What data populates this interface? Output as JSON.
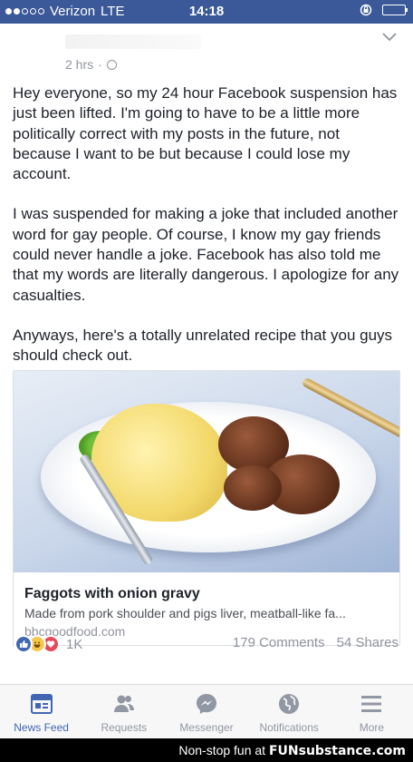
{
  "status_bar": {
    "carrier": "Verizon",
    "network": "LTE",
    "time": "14:18"
  },
  "post": {
    "time_ago": "2 hrs",
    "separator": "·",
    "paragraphs": [
      "Hey everyone, so my 24 hour Facebook suspension has just been lifted. I'm going to have to be a little more politically correct with my posts in the future, not because I want to be but because I could lose my account.",
      "I was suspended for making a joke that included another word for gay people. Of course, I know my gay friends could never handle a joke. Facebook has also told me that my words are literally dangerous. I apologize for any casualties.",
      "Anyways, here's a totally unrelated recipe that you guys should check out."
    ],
    "link": {
      "title": "Faggots with onion gravy",
      "description": "Made from pork shoulder and pigs liver, meatball-like fa...",
      "domain": "bbcgoodfood.com"
    },
    "reaction_count": "1K",
    "comments": "179 Comments",
    "shares": "54 Shares"
  },
  "tabbar": {
    "items": [
      {
        "label": "News Feed",
        "icon": "news-feed-icon",
        "active": true
      },
      {
        "label": "Requests",
        "icon": "friend-requests-icon"
      },
      {
        "label": "Messenger",
        "icon": "messenger-icon"
      },
      {
        "label": "Notifications",
        "icon": "globe-notifications-icon"
      },
      {
        "label": "More",
        "icon": "menu-icon"
      }
    ]
  },
  "watermark": {
    "text": "Non-stop fun at",
    "brand": "FUNsubstance.com"
  },
  "colors": {
    "facebook_blue": "#3b5998",
    "active_tab": "#4267b2",
    "muted_text": "#90949c"
  }
}
